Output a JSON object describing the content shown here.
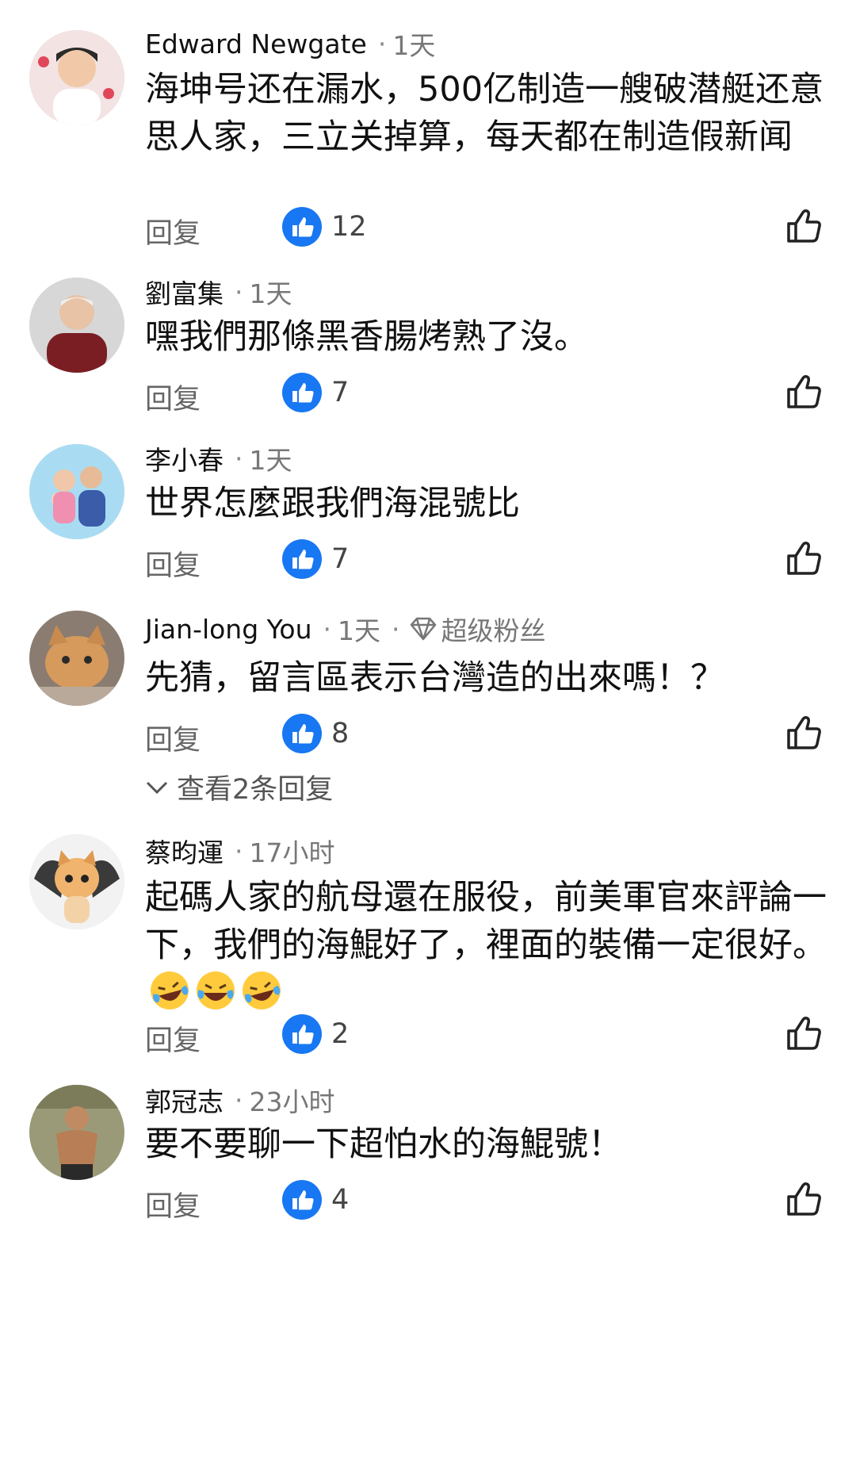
{
  "reply_label": "回复",
  "colors": {
    "like_blue": "#1877f2",
    "time_gray": "#777777"
  },
  "comments": [
    {
      "author": "Edward Newgate",
      "time": "1天",
      "text": "海坤号还在漏水，500亿制造一艘破潜艇还意思人家，三立关掉算，每天都在制造假新闻",
      "likes": "12"
    },
    {
      "author": "劉富集",
      "time": "1天",
      "text": "嘿我們那條黑香腸烤熟了沒。",
      "likes": "7"
    },
    {
      "author": "李小春",
      "time": "1天",
      "text": "世界怎麼跟我們海混號比",
      "likes": "7"
    },
    {
      "author": "Jian-long You",
      "time": "1天",
      "badge": "超级粉丝",
      "text": "先猜，留言區表示台灣造的出來嗎！？",
      "likes": "8",
      "view_replies": "查看2条回复"
    },
    {
      "author": "蔡昀運",
      "time": "17小时",
      "text": "起碼人家的航母還在服役，前美軍官來評論一下，我們的海鯤好了，裡面的裝備一定很好。",
      "likes": "2"
    },
    {
      "author": "郭冠志",
      "time": "23小时",
      "text": "要不要聊一下超怕水的海鯤號！",
      "likes": "4"
    }
  ]
}
